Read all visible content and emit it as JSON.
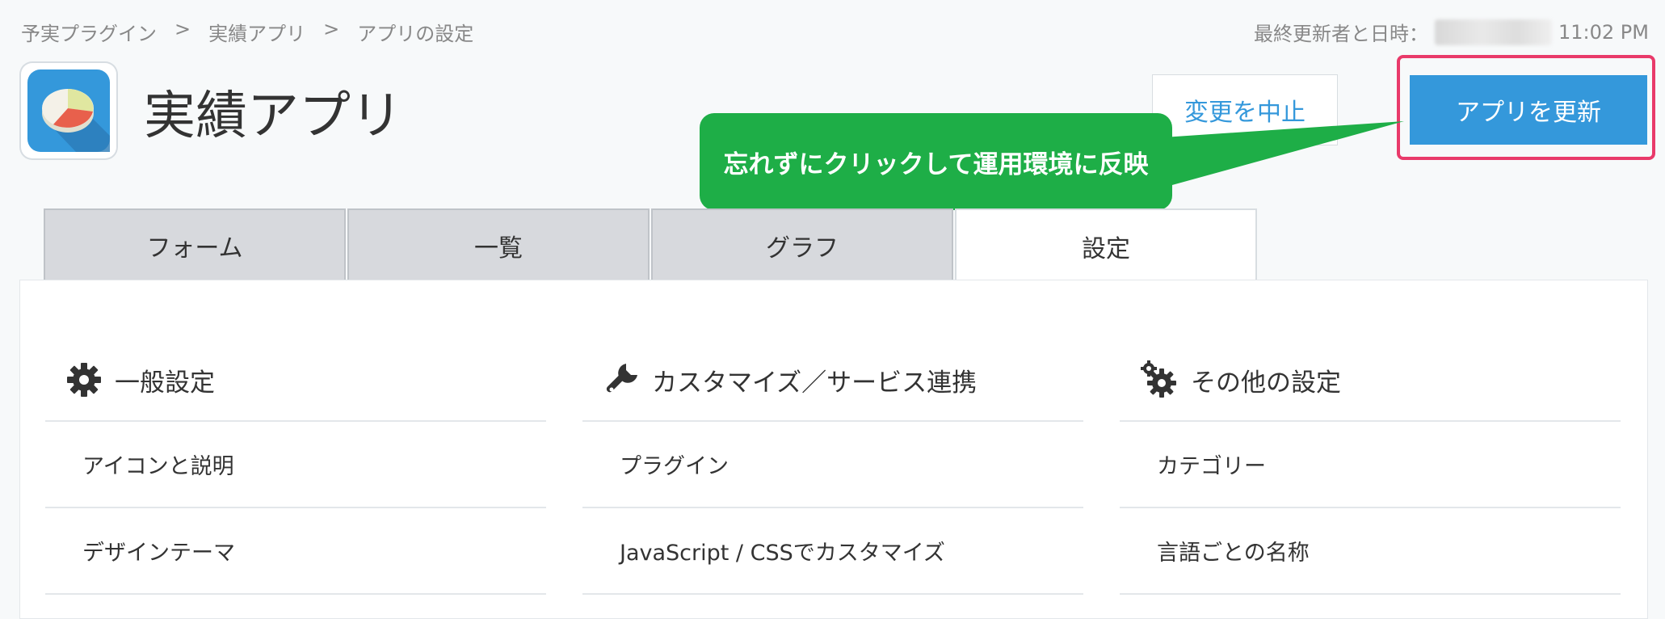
{
  "breadcrumb": {
    "items": [
      "予実プラグイン",
      "実績アプリ",
      "アプリの設定"
    ],
    "separator": ">"
  },
  "modified": {
    "label": "最終更新者と日時：",
    "time": "11:02 PM"
  },
  "app": {
    "title": "実績アプリ",
    "icon": "pie-chart-icon"
  },
  "header": {
    "cancel_label": "変更を中止",
    "update_label": "アプリを更新"
  },
  "callout": {
    "text": "忘れずにクリックして運用環境に反映",
    "color": "#1eae47"
  },
  "tabs": [
    {
      "label": "フォーム",
      "active": false
    },
    {
      "label": "一覧",
      "active": false
    },
    {
      "label": "グラフ",
      "active": false
    },
    {
      "label": "設定",
      "active": true
    }
  ],
  "settings": {
    "general": {
      "title": "一般設定",
      "icon": "gear-icon",
      "items": [
        "アイコンと説明",
        "デザインテーマ"
      ]
    },
    "customize": {
      "title": "カスタマイズ／サービス連携",
      "icon": "wrench-icon",
      "items": [
        "プラグイン",
        "JavaScript / CSSでカスタマイズ"
      ]
    },
    "other": {
      "title": "その他の設定",
      "icon": "gears-icon",
      "items": [
        "カテゴリー",
        "言語ごとの名称"
      ]
    }
  },
  "colors": {
    "accent": "#3498db",
    "highlight": "#e93a6a",
    "callout": "#1eae47"
  }
}
